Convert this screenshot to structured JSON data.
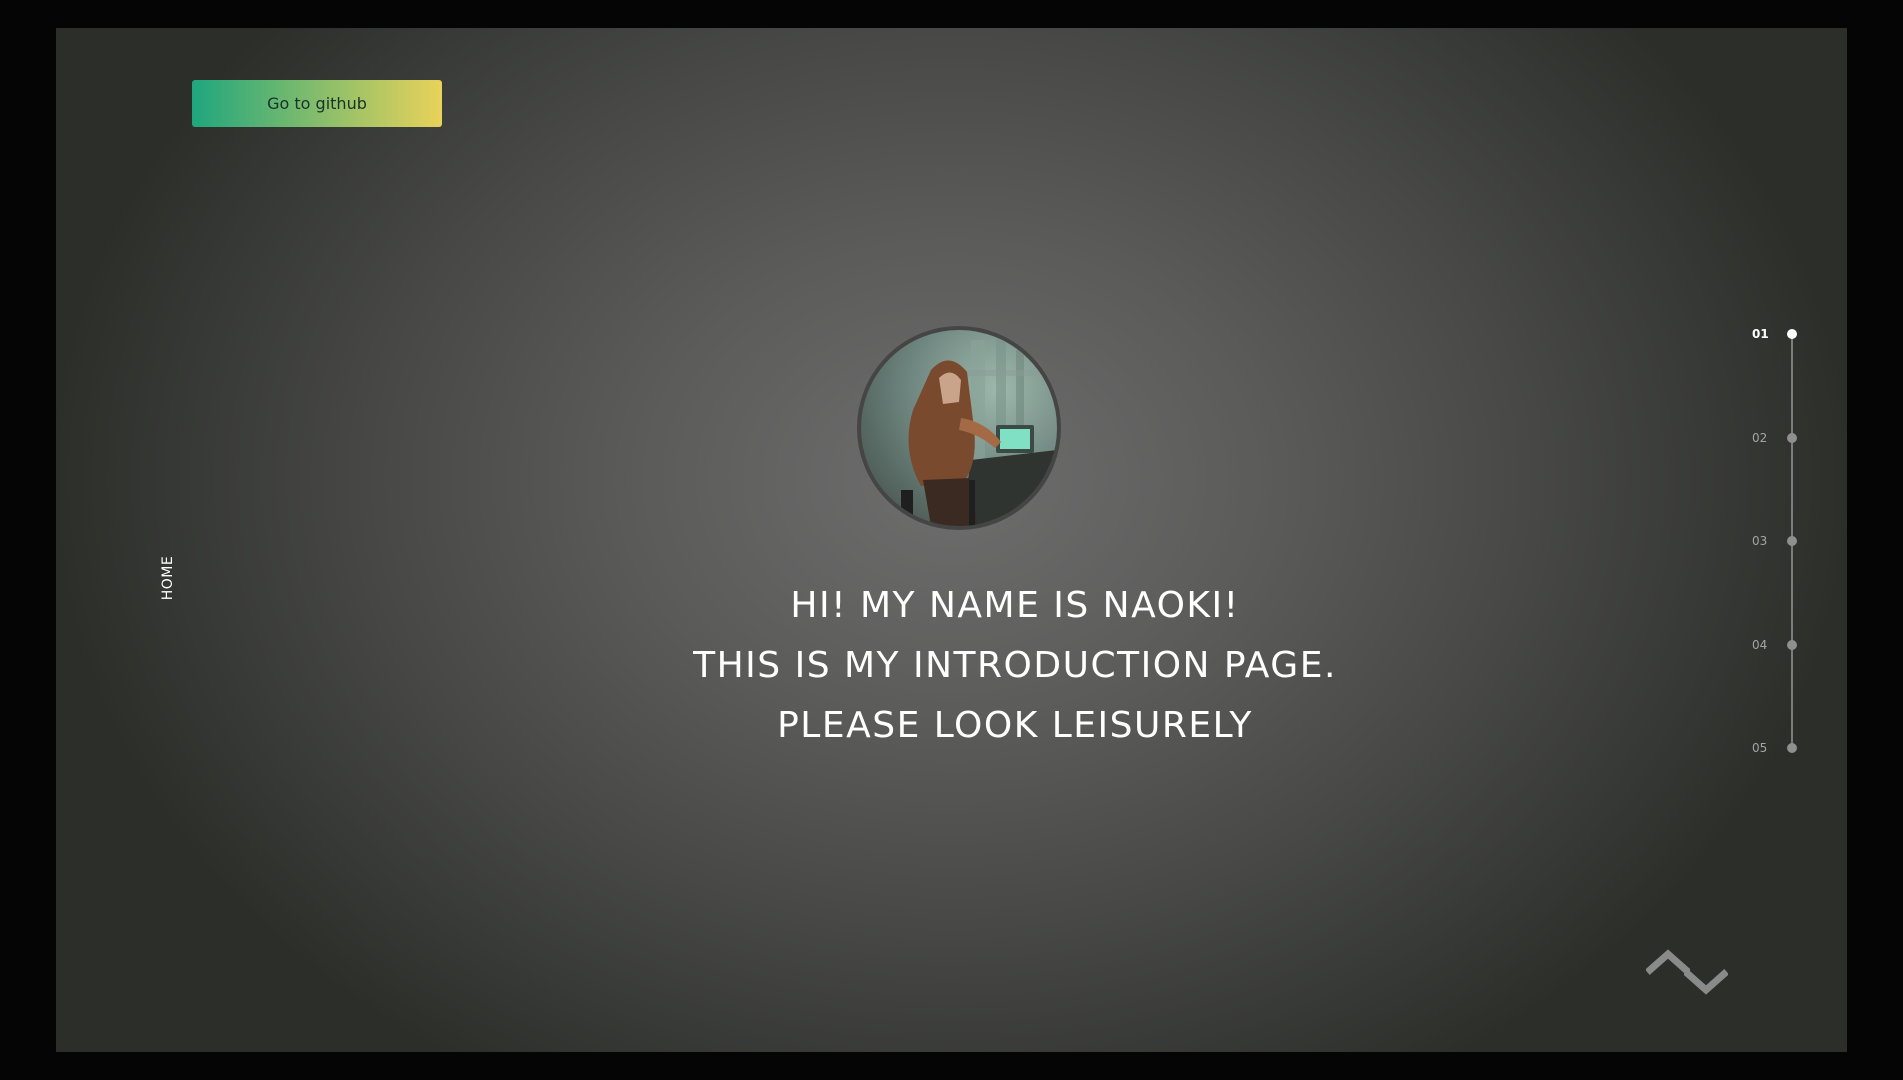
{
  "header": {
    "github_button_label": "Go to github"
  },
  "side": {
    "section_label": "HOME"
  },
  "hero": {
    "lines": [
      "HI! MY NAME IS NAOKI!",
      "THIS IS MY INTRODUCTION PAGE.",
      "PLEASE LOOK LEISURELY"
    ]
  },
  "pagination": {
    "active": "01",
    "items": [
      {
        "label": "01"
      },
      {
        "label": "02"
      },
      {
        "label": "03"
      },
      {
        "label": "04"
      },
      {
        "label": "05"
      }
    ]
  },
  "arrows": {
    "up_icon": "chevron-up-icon",
    "down_icon": "chevron-down-icon",
    "color": "#8a8a8a"
  },
  "colors": {
    "button_gradient_start": "#1fa67e",
    "button_gradient_end": "#e9d25a",
    "text": "#ffffff"
  }
}
